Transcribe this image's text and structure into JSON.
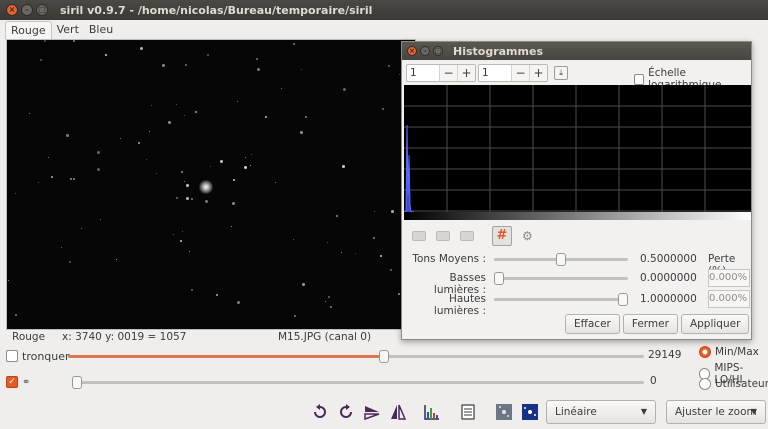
{
  "window": {
    "title": "siril v0.9.7 - /home/nicolas/Bureau/temporaire/siril"
  },
  "tabs": [
    {
      "label": "Rouge",
      "active": true
    },
    {
      "label": "Vert",
      "active": false
    },
    {
      "label": "Bleu",
      "active": false
    }
  ],
  "status": {
    "channel": "Rouge",
    "coords": "x: 3740 y: 0019 = 1057",
    "filename": "M15.JPG (canal 0)"
  },
  "histogram": {
    "title": "Histogrammes",
    "spin1": "1",
    "spin2": "1",
    "log_label": "Échelle logarithmique",
    "log_checked": false,
    "perte_label": "Perte (%)",
    "sliders": [
      {
        "label": "Tons Moyens :",
        "value": "0.5000000",
        "level": 0.5
      },
      {
        "label": "Basses lumières :",
        "value": "0.0000000",
        "perte": "0.000%",
        "level": 0.0
      },
      {
        "label": "Hautes lumières :",
        "value": "1.0000000",
        "perte": "0.000%",
        "level": 1.0
      }
    ],
    "buttons": {
      "clear": "Effacer",
      "close": "Fermer",
      "apply": "Appliquer"
    }
  },
  "controls": {
    "tronquer_label": "tronquer",
    "tronquer_checked": false,
    "high_value": "29149",
    "high_level": 0.55,
    "low_value": "0",
    "low_level": 0.0,
    "link_checked": true,
    "radios": [
      {
        "label": "Min/Max",
        "selected": true
      },
      {
        "label": "MIPS-LO/HI",
        "selected": false
      },
      {
        "label": "Utilisateur",
        "selected": false
      }
    ]
  },
  "toolbar": {
    "display_mode": "Linéaire",
    "zoom": "Ajuster le zoom"
  },
  "colors": {
    "accent": "#e35b25",
    "titlebar": "#3c3b37"
  }
}
